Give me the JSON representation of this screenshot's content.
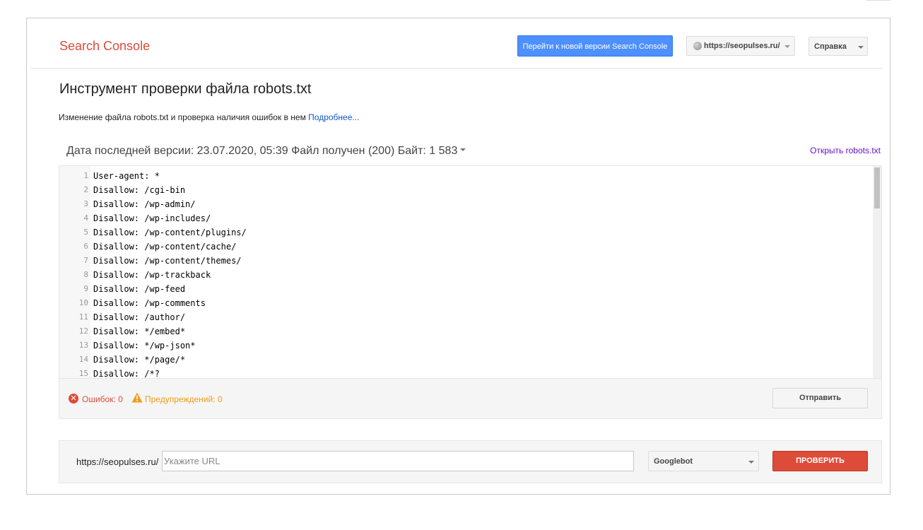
{
  "header": {
    "logo": "Search Console",
    "new_version_button": "Перейти к новой версии Search Console",
    "site_selector": "https://seopulses.ru/",
    "help_menu": "Справка"
  },
  "page": {
    "title": "Инструмент проверки файла robots.txt",
    "description": "Изменение файла robots.txt и проверка наличия ошибок в нем",
    "learn_more": "Подробнее..."
  },
  "version": {
    "info": "Дата последней версии: 23.07.2020, 05:39 Файл получен (200) Байт: 1 583",
    "open_link": "Открыть robots.txt"
  },
  "editor": {
    "lines": [
      {
        "num": "1",
        "text": "User-agent: *"
      },
      {
        "num": "2",
        "text": "Disallow: /cgi-bin"
      },
      {
        "num": "3",
        "text": "Disallow: /wp-admin/"
      },
      {
        "num": "4",
        "text": "Disallow: /wp-includes/"
      },
      {
        "num": "5",
        "text": "Disallow: /wp-content/plugins/"
      },
      {
        "num": "6",
        "text": "Disallow: /wp-content/cache/"
      },
      {
        "num": "7",
        "text": "Disallow: /wp-content/themes/"
      },
      {
        "num": "8",
        "text": "Disallow: /wp-trackback"
      },
      {
        "num": "9",
        "text": "Disallow: /wp-feed"
      },
      {
        "num": "10",
        "text": "Disallow: /wp-comments"
      },
      {
        "num": "11",
        "text": "Disallow: /author/"
      },
      {
        "num": "12",
        "text": "Disallow: */embed*"
      },
      {
        "num": "13",
        "text": "Disallow: */wp-json*"
      },
      {
        "num": "14",
        "text": "Disallow: */page/*"
      },
      {
        "num": "15",
        "text": "Disallow: /*?"
      }
    ]
  },
  "status": {
    "errors": "Ошибок: 0",
    "warnings": "Предупреждений: 0",
    "submit_button": "Отправить"
  },
  "tester": {
    "url_prefix": "https://seopulses.ru/",
    "url_placeholder": "Укажите URL",
    "bot_selected": "Googlebot",
    "check_button": "ПРОВЕРИТЬ"
  },
  "colors": {
    "brand_red": "#dd4b39",
    "primary_blue": "#4d90fe",
    "link_blue": "#1155cc",
    "visited_purple": "#6611cc",
    "warning_orange": "#f39b17"
  }
}
